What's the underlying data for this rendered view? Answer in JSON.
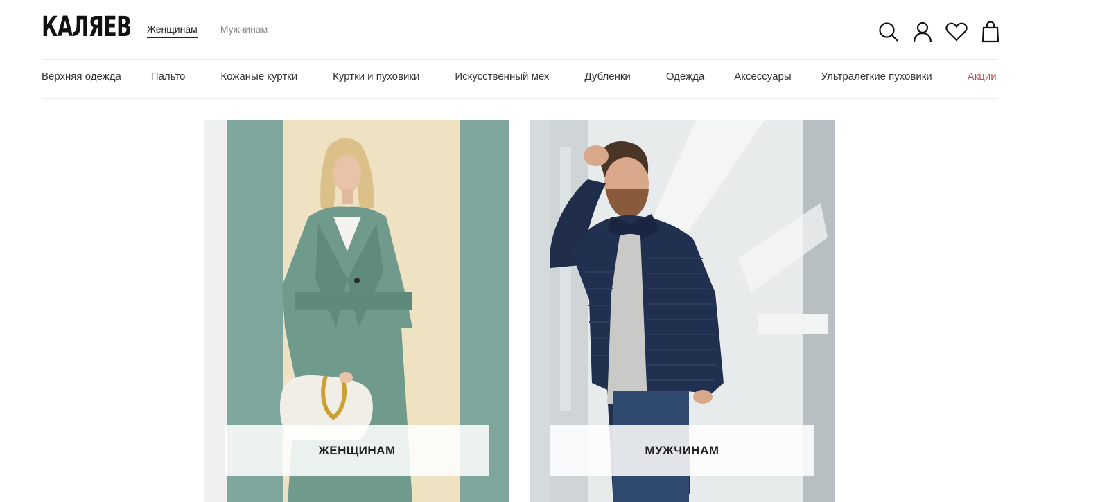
{
  "header": {
    "logo_text": "КАЛЯЕВ",
    "gender_nav": [
      {
        "label": "Женщинам",
        "active": true
      },
      {
        "label": "Мужчинам",
        "active": false
      }
    ],
    "icons": [
      "search-icon",
      "user-icon",
      "heart-icon",
      "bag-icon"
    ]
  },
  "category_nav": [
    {
      "label": "Верхняя одежда"
    },
    {
      "label": "Пальто"
    },
    {
      "label": "Кожаные куртки"
    },
    {
      "label": "Куртки и пуховики"
    },
    {
      "label": "Искусственный мех"
    },
    {
      "label": "Дубленки"
    },
    {
      "label": "Одежда"
    },
    {
      "label": "Аксессуары"
    },
    {
      "label": "Ультралегкие пуховики"
    },
    {
      "label": "Акции"
    }
  ],
  "cards": [
    {
      "label": "ЖЕНЩИНАМ"
    },
    {
      "label": "МУЖЧИНАМ"
    }
  ],
  "colors": {
    "sale": "#b3545b",
    "active_underline": "#222222",
    "inactive_link": "#8a8a8a"
  }
}
